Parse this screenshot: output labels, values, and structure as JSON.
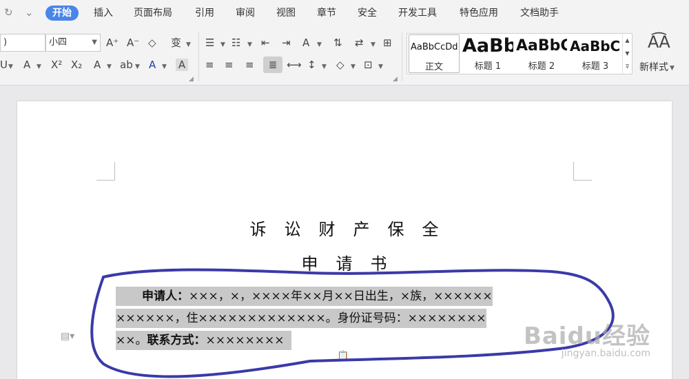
{
  "quick_access": {
    "redo": "↻",
    "more": "⌄"
  },
  "menu_tabs": [
    "开始",
    "插入",
    "页面布局",
    "引用",
    "审阅",
    "视图",
    "章节",
    "安全",
    "开发工具",
    "特色应用",
    "文档助手"
  ],
  "font": {
    "name_value": ")",
    "size_value": "小四"
  },
  "styles": {
    "normal": {
      "sample": "AaBbCcDd",
      "name": "正文"
    },
    "h1": {
      "sample": "AaBb",
      "name": "标题 1"
    },
    "h2": {
      "sample": "AaBbC",
      "name": "标题 2"
    },
    "h3": {
      "sample": "AaBbC",
      "name": "标题 3"
    },
    "new_style": "新样式"
  },
  "document": {
    "title_line1": "诉　讼　财　产　保　全",
    "title_line2": "申　请　书",
    "para": {
      "label_applicant": "申请人：",
      "line1_text": "×××，×，××××年××月××日出生，×族，××××××",
      "line2_text": "××××××，住×××××××××××××。身份证号码：××××××××",
      "line3_prefix": "××。",
      "label_contact": "联系方式：",
      "line3_text": "××××××××"
    }
  },
  "watermark": {
    "brand": "Baidu经验",
    "url": "jingyan.baidu.com"
  },
  "colors": {
    "accent": "#4a86e8",
    "annotation": "#3a3aa8",
    "highlight": "#c8c8c8"
  }
}
